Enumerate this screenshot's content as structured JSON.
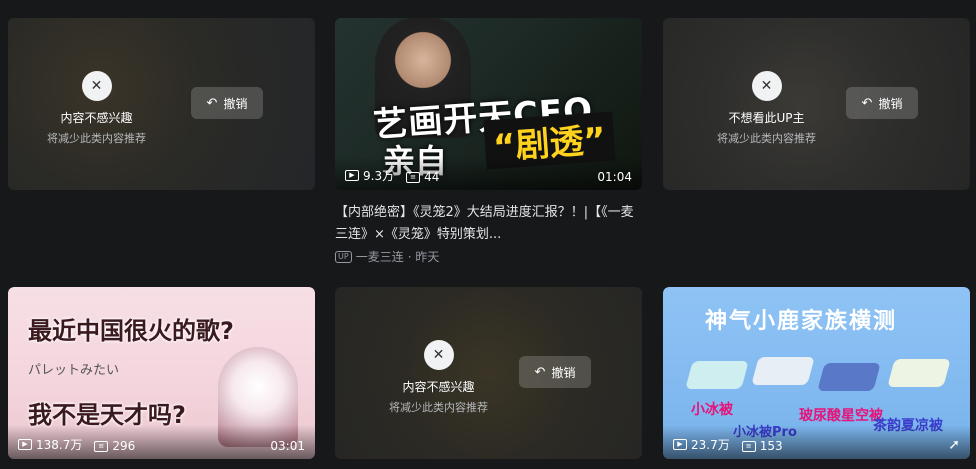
{
  "dismissed_cards": [
    {
      "title": "内容不感兴趣",
      "subtitle": "将减少此类内容推荐",
      "undo_label": "撤销"
    },
    {
      "title": "不想看此UP主",
      "subtitle": "将减少此类内容推荐",
      "undo_label": "撤销"
    },
    {
      "title": "内容不感兴趣",
      "subtitle": "将减少此类内容推荐",
      "undo_label": "撤销"
    }
  ],
  "videos": [
    {
      "views": "9.3万",
      "danmaku": "44",
      "duration": "01:04",
      "title": "【内部绝密】《灵笼2》大结局进度汇报？！|【《一麦三连》×《灵笼》特别策划...",
      "up_badge": "UP",
      "author": "一麦三连",
      "date": "· 昨天",
      "art": {
        "line1": "艺画开天CEO",
        "line2": "亲自",
        "line3": "“剧透”"
      }
    },
    {
      "views": "138.7万",
      "danmaku": "296",
      "duration": "03:01",
      "art": {
        "line1": "最近中国很火的歌?",
        "jp": "パレットみたい",
        "line2": "我不是天才吗?"
      }
    },
    {
      "views": "23.7万",
      "danmaku": "153",
      "art": {
        "title": "神气小鹿家族横测",
        "l1": "小冰被",
        "l2": "小冰被Pro",
        "l3": "玻尿酸星空被",
        "l4": "茶韵夏凉被"
      }
    }
  ],
  "icons": {
    "dislike": "dislike-face-icon",
    "undo": "undo-icon",
    "play": "play-icon",
    "danmaku": "danmaku-icon",
    "share": "share-icon"
  },
  "colors": {
    "background": "#17181a",
    "muted": "#9499a0",
    "accent_pink": "#e6137a"
  }
}
